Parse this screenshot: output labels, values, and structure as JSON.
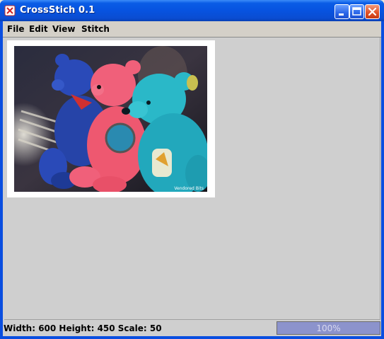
{
  "window": {
    "title": "CrossStich 0.1"
  },
  "menubar": {
    "items": [
      "File",
      "Edit",
      "View",
      "Stitch"
    ]
  },
  "canvas": {
    "image_caption": "Three teddy bears (blue, pink, teal) sitting in a row",
    "watermark": "Vendored Bits"
  },
  "statusbar": {
    "dimensions_text": "Width: 600 Height: 450 Scale: 50",
    "progress_text": "100%",
    "progress_value": 1.0
  },
  "colors": {
    "titlebar_blue": "#0a53e0",
    "client_gray": "#cfcfcf",
    "progress_fill": "#8c93cc",
    "close_red": "#e2542a"
  },
  "icons": {
    "app": "crossstitch-app-icon",
    "minimize": "minimize-icon",
    "maximize": "maximize-icon",
    "close": "close-icon"
  }
}
